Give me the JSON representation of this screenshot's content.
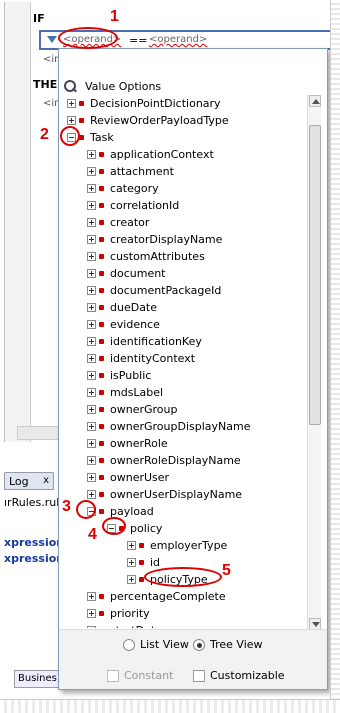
{
  "editor": {
    "if_label": "IF",
    "then_label": "THEN",
    "insert_hint_1": "<ins",
    "insert_hint_2": "<ins",
    "left_operand": "<operand>",
    "operator": "==",
    "right_operand": "<operand>"
  },
  "background": {
    "log_tab": "Log",
    "log_tab_close": "x",
    "rules_file": "ırRules.rule",
    "expr_1": "xpression",
    "expr_2": "xpression",
    "frag_1": "/",
    "frag_2": "/",
    "bottom_tab": "Busines"
  },
  "popup": {
    "title": "Value Options",
    "tree": [
      {
        "label": "DecisionPointDictionary",
        "level": 0,
        "expander": "plus"
      },
      {
        "label": "ReviewOrderPayloadType",
        "level": 0,
        "expander": "plus"
      },
      {
        "label": "Task",
        "level": 0,
        "expander": "minus"
      },
      {
        "label": "applicationContext",
        "level": 1,
        "expander": "plus"
      },
      {
        "label": "attachment",
        "level": 1,
        "expander": "plus"
      },
      {
        "label": "category",
        "level": 1,
        "expander": "plus"
      },
      {
        "label": "correlationId",
        "level": 1,
        "expander": "plus"
      },
      {
        "label": "creator",
        "level": 1,
        "expander": "plus"
      },
      {
        "label": "creatorDisplayName",
        "level": 1,
        "expander": "plus"
      },
      {
        "label": "customAttributes",
        "level": 1,
        "expander": "plus"
      },
      {
        "label": "document",
        "level": 1,
        "expander": "plus"
      },
      {
        "label": "documentPackageId",
        "level": 1,
        "expander": "plus"
      },
      {
        "label": "dueDate",
        "level": 1,
        "expander": "plus"
      },
      {
        "label": "evidence",
        "level": 1,
        "expander": "plus"
      },
      {
        "label": "identificationKey",
        "level": 1,
        "expander": "plus"
      },
      {
        "label": "identityContext",
        "level": 1,
        "expander": "plus"
      },
      {
        "label": "isPublic",
        "level": 1,
        "expander": "plus"
      },
      {
        "label": "mdsLabel",
        "level": 1,
        "expander": "plus"
      },
      {
        "label": "ownerGroup",
        "level": 1,
        "expander": "plus"
      },
      {
        "label": "ownerGroupDisplayName",
        "level": 1,
        "expander": "plus"
      },
      {
        "label": "ownerRole",
        "level": 1,
        "expander": "plus"
      },
      {
        "label": "ownerRoleDisplayName",
        "level": 1,
        "expander": "plus"
      },
      {
        "label": "ownerUser",
        "level": 1,
        "expander": "plus"
      },
      {
        "label": "ownerUserDisplayName",
        "level": 1,
        "expander": "plus"
      },
      {
        "label": "payload",
        "level": 1,
        "expander": "minus"
      },
      {
        "label": "policy",
        "level": 2,
        "expander": "minus"
      },
      {
        "label": "employerType",
        "level": 3,
        "expander": "plus"
      },
      {
        "label": "id",
        "level": 3,
        "expander": "plus"
      },
      {
        "label": "policyType",
        "level": 3,
        "expander": "plus"
      },
      {
        "label": "percentageComplete",
        "level": 1,
        "expander": "plus"
      },
      {
        "label": "priority",
        "level": 1,
        "expander": "plus"
      },
      {
        "label": "startDate",
        "level": 1,
        "expander": "plus"
      }
    ],
    "list_view": "List View",
    "tree_view": "Tree View",
    "view_mode": "tree",
    "constant": "Constant",
    "customizable": "Customizable"
  },
  "annotations": [
    "1",
    "2",
    "3",
    "4",
    "5"
  ],
  "colors": {
    "annotation": "#e00000",
    "bullet": "#cc0000",
    "border": "#7f9db9"
  }
}
